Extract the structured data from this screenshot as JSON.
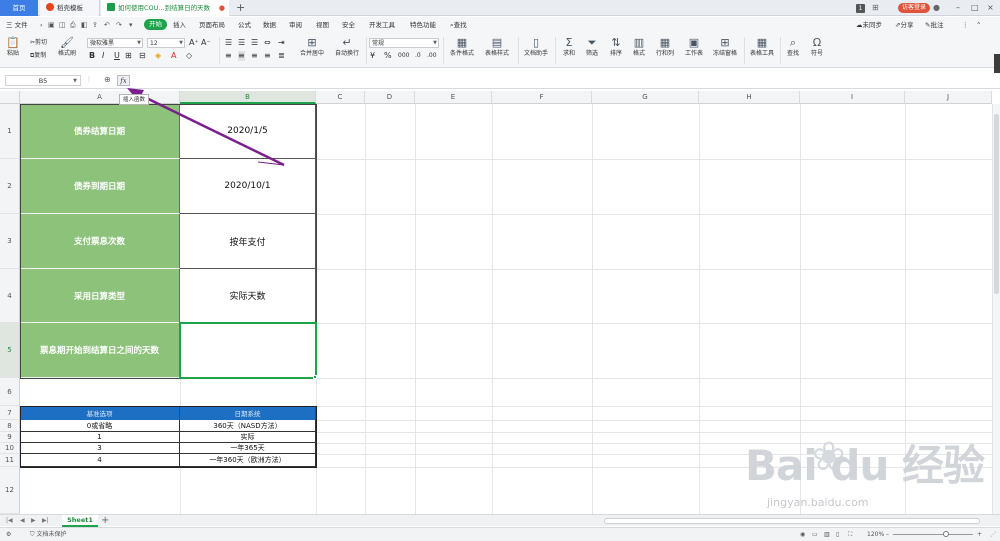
{
  "tabs": {
    "home": "首页",
    "template": "稻壳模板",
    "document": "如何使用COU...到结算日的天数",
    "add": "+"
  },
  "titlebar_right": {
    "badge": "1",
    "visitor": "访客登录"
  },
  "menu": {
    "file": "三 文件",
    "items": [
      "开始",
      "插入",
      "页面布局",
      "公式",
      "数据",
      "审阅",
      "视图",
      "安全",
      "开发工具",
      "特色功能"
    ],
    "search": "查找",
    "sync": "未同步",
    "share": "分享",
    "comment": "批注"
  },
  "ribbon": {
    "paste": "粘贴",
    "cut": "剪切",
    "copy": "复制",
    "format_painter": "格式刷",
    "font": "微软雅黑",
    "size": "12",
    "bold": "B",
    "italic": "I",
    "underline": "U",
    "merge": "合并居中",
    "wrap": "自动换行",
    "numfmt": "常规",
    "cond_format": "条件格式",
    "table_style": "表格样式",
    "doc_helper": "文档助手",
    "sum": "求和",
    "filter": "筛选",
    "sort": "排序",
    "format": "格式",
    "rowcol": "行和列",
    "worksheet": "工作表",
    "freeze": "冻结窗格",
    "table_tools": "表格工具",
    "find": "查找",
    "symbol": "符号"
  },
  "formula_bar": {
    "cell_ref": "B5",
    "fx": "fx",
    "tooltip": "插入函数"
  },
  "columns": [
    "A",
    "B",
    "C",
    "D",
    "E",
    "F",
    "G",
    "H",
    "I",
    "J"
  ],
  "rows": [
    "1",
    "2",
    "3",
    "4",
    "5",
    "6",
    "7",
    "8",
    "9",
    "10",
    "11",
    "12"
  ],
  "sheet": {
    "main_table": [
      {
        "label": "债券结算日期",
        "value": "2020/1/5"
      },
      {
        "label": "债券到期日期",
        "value": "2020/10/1"
      },
      {
        "label": "支付票息次数",
        "value": "按年支付"
      },
      {
        "label": "采用日算类型",
        "value": "实际天数"
      },
      {
        "label": "票息期开始到结算日之间的天数",
        "value": ""
      }
    ],
    "ref_table": {
      "headers": [
        "基准选项",
        "日期系统"
      ],
      "rows": [
        [
          "0或省略",
          "360天（NASD方法）"
        ],
        [
          "1",
          "实际"
        ],
        [
          "3",
          "一年365天"
        ],
        [
          "4",
          "一年360天（欧洲方法）"
        ]
      ]
    }
  },
  "sheet_tabs": {
    "active": "Sheet1",
    "add": "+"
  },
  "status": {
    "protect": "文档未保护",
    "zoom": "120%"
  },
  "watermark": {
    "main": "Bai du 经验",
    "sub": "jingyan.baidu.com"
  },
  "colors": {
    "accent_green": "#1fa34a",
    "label_fill": "#8cc27a",
    "header_blue": "#1d6fc3",
    "arrow": "#7b1f8c"
  }
}
